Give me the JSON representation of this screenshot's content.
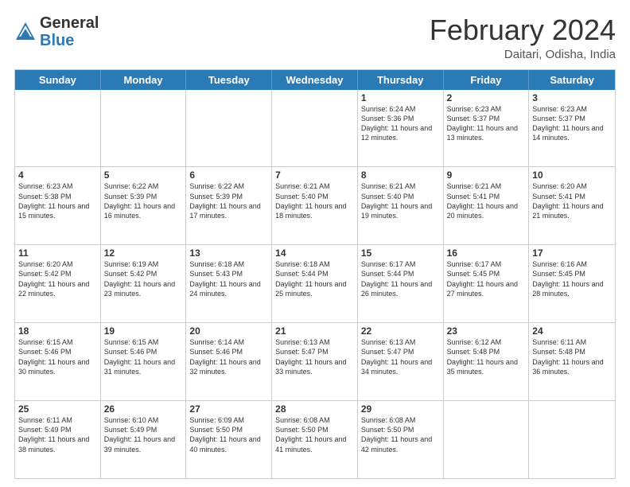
{
  "header": {
    "logo_general": "General",
    "logo_blue": "Blue",
    "month_year": "February 2024",
    "location": "Daitari, Odisha, India"
  },
  "days_of_week": [
    "Sunday",
    "Monday",
    "Tuesday",
    "Wednesday",
    "Thursday",
    "Friday",
    "Saturday"
  ],
  "weeks": [
    [
      {
        "day": "",
        "sunrise": "",
        "sunset": "",
        "daylight": ""
      },
      {
        "day": "",
        "sunrise": "",
        "sunset": "",
        "daylight": ""
      },
      {
        "day": "",
        "sunrise": "",
        "sunset": "",
        "daylight": ""
      },
      {
        "day": "",
        "sunrise": "",
        "sunset": "",
        "daylight": ""
      },
      {
        "day": "1",
        "sunrise": "Sunrise: 6:24 AM",
        "sunset": "Sunset: 5:36 PM",
        "daylight": "Daylight: 11 hours and 12 minutes."
      },
      {
        "day": "2",
        "sunrise": "Sunrise: 6:23 AM",
        "sunset": "Sunset: 5:37 PM",
        "daylight": "Daylight: 11 hours and 13 minutes."
      },
      {
        "day": "3",
        "sunrise": "Sunrise: 6:23 AM",
        "sunset": "Sunset: 5:37 PM",
        "daylight": "Daylight: 11 hours and 14 minutes."
      }
    ],
    [
      {
        "day": "4",
        "sunrise": "Sunrise: 6:23 AM",
        "sunset": "Sunset: 5:38 PM",
        "daylight": "Daylight: 11 hours and 15 minutes."
      },
      {
        "day": "5",
        "sunrise": "Sunrise: 6:22 AM",
        "sunset": "Sunset: 5:39 PM",
        "daylight": "Daylight: 11 hours and 16 minutes."
      },
      {
        "day": "6",
        "sunrise": "Sunrise: 6:22 AM",
        "sunset": "Sunset: 5:39 PM",
        "daylight": "Daylight: 11 hours and 17 minutes."
      },
      {
        "day": "7",
        "sunrise": "Sunrise: 6:21 AM",
        "sunset": "Sunset: 5:40 PM",
        "daylight": "Daylight: 11 hours and 18 minutes."
      },
      {
        "day": "8",
        "sunrise": "Sunrise: 6:21 AM",
        "sunset": "Sunset: 5:40 PM",
        "daylight": "Daylight: 11 hours and 19 minutes."
      },
      {
        "day": "9",
        "sunrise": "Sunrise: 6:21 AM",
        "sunset": "Sunset: 5:41 PM",
        "daylight": "Daylight: 11 hours and 20 minutes."
      },
      {
        "day": "10",
        "sunrise": "Sunrise: 6:20 AM",
        "sunset": "Sunset: 5:41 PM",
        "daylight": "Daylight: 11 hours and 21 minutes."
      }
    ],
    [
      {
        "day": "11",
        "sunrise": "Sunrise: 6:20 AM",
        "sunset": "Sunset: 5:42 PM",
        "daylight": "Daylight: 11 hours and 22 minutes."
      },
      {
        "day": "12",
        "sunrise": "Sunrise: 6:19 AM",
        "sunset": "Sunset: 5:42 PM",
        "daylight": "Daylight: 11 hours and 23 minutes."
      },
      {
        "day": "13",
        "sunrise": "Sunrise: 6:18 AM",
        "sunset": "Sunset: 5:43 PM",
        "daylight": "Daylight: 11 hours and 24 minutes."
      },
      {
        "day": "14",
        "sunrise": "Sunrise: 6:18 AM",
        "sunset": "Sunset: 5:44 PM",
        "daylight": "Daylight: 11 hours and 25 minutes."
      },
      {
        "day": "15",
        "sunrise": "Sunrise: 6:17 AM",
        "sunset": "Sunset: 5:44 PM",
        "daylight": "Daylight: 11 hours and 26 minutes."
      },
      {
        "day": "16",
        "sunrise": "Sunrise: 6:17 AM",
        "sunset": "Sunset: 5:45 PM",
        "daylight": "Daylight: 11 hours and 27 minutes."
      },
      {
        "day": "17",
        "sunrise": "Sunrise: 6:16 AM",
        "sunset": "Sunset: 5:45 PM",
        "daylight": "Daylight: 11 hours and 28 minutes."
      }
    ],
    [
      {
        "day": "18",
        "sunrise": "Sunrise: 6:15 AM",
        "sunset": "Sunset: 5:46 PM",
        "daylight": "Daylight: 11 hours and 30 minutes."
      },
      {
        "day": "19",
        "sunrise": "Sunrise: 6:15 AM",
        "sunset": "Sunset: 5:46 PM",
        "daylight": "Daylight: 11 hours and 31 minutes."
      },
      {
        "day": "20",
        "sunrise": "Sunrise: 6:14 AM",
        "sunset": "Sunset: 5:46 PM",
        "daylight": "Daylight: 11 hours and 32 minutes."
      },
      {
        "day": "21",
        "sunrise": "Sunrise: 6:13 AM",
        "sunset": "Sunset: 5:47 PM",
        "daylight": "Daylight: 11 hours and 33 minutes."
      },
      {
        "day": "22",
        "sunrise": "Sunrise: 6:13 AM",
        "sunset": "Sunset: 5:47 PM",
        "daylight": "Daylight: 11 hours and 34 minutes."
      },
      {
        "day": "23",
        "sunrise": "Sunrise: 6:12 AM",
        "sunset": "Sunset: 5:48 PM",
        "daylight": "Daylight: 11 hours and 35 minutes."
      },
      {
        "day": "24",
        "sunrise": "Sunrise: 6:11 AM",
        "sunset": "Sunset: 5:48 PM",
        "daylight": "Daylight: 11 hours and 36 minutes."
      }
    ],
    [
      {
        "day": "25",
        "sunrise": "Sunrise: 6:11 AM",
        "sunset": "Sunset: 5:49 PM",
        "daylight": "Daylight: 11 hours and 38 minutes."
      },
      {
        "day": "26",
        "sunrise": "Sunrise: 6:10 AM",
        "sunset": "Sunset: 5:49 PM",
        "daylight": "Daylight: 11 hours and 39 minutes."
      },
      {
        "day": "27",
        "sunrise": "Sunrise: 6:09 AM",
        "sunset": "Sunset: 5:50 PM",
        "daylight": "Daylight: 11 hours and 40 minutes."
      },
      {
        "day": "28",
        "sunrise": "Sunrise: 6:08 AM",
        "sunset": "Sunset: 5:50 PM",
        "daylight": "Daylight: 11 hours and 41 minutes."
      },
      {
        "day": "29",
        "sunrise": "Sunrise: 6:08 AM",
        "sunset": "Sunset: 5:50 PM",
        "daylight": "Daylight: 11 hours and 42 minutes."
      },
      {
        "day": "",
        "sunrise": "",
        "sunset": "",
        "daylight": ""
      },
      {
        "day": "",
        "sunrise": "",
        "sunset": "",
        "daylight": ""
      }
    ]
  ]
}
